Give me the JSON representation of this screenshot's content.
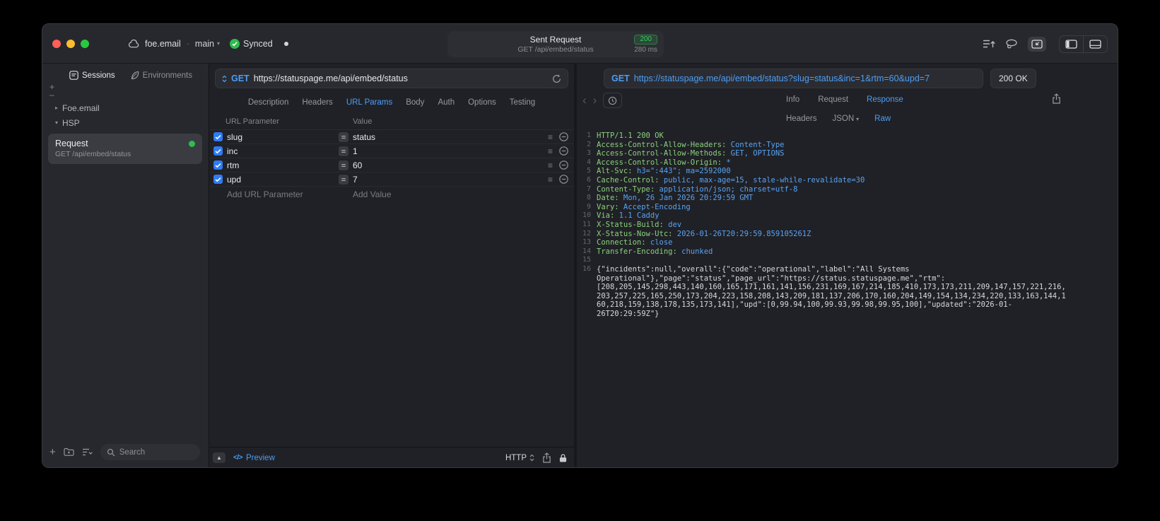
{
  "titlebar": {
    "project": "foe.email",
    "branch": "main",
    "sync_status": "Synced",
    "request_capsule": {
      "title": "Sent Request",
      "subtitle": "GET /api/embed/status",
      "status_code": "200",
      "duration": "280 ms"
    }
  },
  "sidebar": {
    "tabs": [
      {
        "label": "Sessions"
      },
      {
        "label": "Environments"
      }
    ],
    "tree": [
      {
        "label": "Foe.email"
      },
      {
        "label": "HSP"
      }
    ],
    "request_item": {
      "title": "Request",
      "subtitle": "GET /api/embed/status"
    },
    "search_placeholder": "Search"
  },
  "request": {
    "method": "GET",
    "url": "https://statuspage.me/api/embed/status",
    "tabs": [
      "Description",
      "Headers",
      "URL Params",
      "Body",
      "Auth",
      "Options",
      "Testing"
    ],
    "active_tab": "URL Params",
    "params_table": {
      "columns": [
        "URL Parameter",
        "Value"
      ],
      "rows": [
        {
          "enabled": true,
          "name": "slug",
          "value": "status"
        },
        {
          "enabled": true,
          "name": "inc",
          "value": "1"
        },
        {
          "enabled": true,
          "name": "rtm",
          "value": "60"
        },
        {
          "enabled": true,
          "name": "upd",
          "value": "7"
        }
      ],
      "add_row": {
        "name_placeholder": "Add URL Parameter",
        "value_placeholder": "Add Value"
      }
    },
    "footer": {
      "preview_label": "Preview",
      "protocol": "HTTP"
    }
  },
  "response": {
    "method": "GET",
    "url": "https://statuspage.me/api/embed/status?slug=status&inc=1&rtm=60&upd=7",
    "status": "200 OK",
    "tabs": [
      "Info",
      "Request",
      "Response"
    ],
    "active_tab": "Response",
    "subtabs": [
      "Headers",
      "JSON",
      "Raw"
    ],
    "active_subtab": "Raw",
    "body_lines": [
      {
        "n": "1",
        "parts": [
          {
            "t": "HTTP/1.1 200 OK",
            "c": "g"
          }
        ]
      },
      {
        "n": "2",
        "parts": [
          {
            "t": "Access-Control-Allow-Headers:",
            "c": "g"
          },
          {
            "t": " Content-Type",
            "c": "b"
          }
        ]
      },
      {
        "n": "3",
        "parts": [
          {
            "t": "Access-Control-Allow-Methods:",
            "c": "g"
          },
          {
            "t": " GET, OPTIONS",
            "c": "b"
          }
        ]
      },
      {
        "n": "4",
        "parts": [
          {
            "t": "Access-Control-Allow-Origin:",
            "c": "g"
          },
          {
            "t": " *",
            "c": "b"
          }
        ]
      },
      {
        "n": "5",
        "parts": [
          {
            "t": "Alt-Svc:",
            "c": "g"
          },
          {
            "t": " h3=\":443\"; ma=2592000",
            "c": "b"
          }
        ]
      },
      {
        "n": "6",
        "parts": [
          {
            "t": "Cache-Control:",
            "c": "g"
          },
          {
            "t": " public, max-age=15, stale-while-revalidate=30",
            "c": "b"
          }
        ]
      },
      {
        "n": "7",
        "parts": [
          {
            "t": "Content-Type:",
            "c": "g"
          },
          {
            "t": " application/json; charset=utf-8",
            "c": "b"
          }
        ]
      },
      {
        "n": "8",
        "parts": [
          {
            "t": "Date:",
            "c": "g"
          },
          {
            "t": " Mon, 26 Jan 2026 20:29:59 GMT",
            "c": "b"
          }
        ]
      },
      {
        "n": "9",
        "parts": [
          {
            "t": "Vary:",
            "c": "g"
          },
          {
            "t": " Accept-Encoding",
            "c": "b"
          }
        ]
      },
      {
        "n": "10",
        "parts": [
          {
            "t": "Via:",
            "c": "g"
          },
          {
            "t": " 1.1 Caddy",
            "c": "b"
          }
        ]
      },
      {
        "n": "11",
        "parts": [
          {
            "t": "X-Status-Build:",
            "c": "g"
          },
          {
            "t": " dev",
            "c": "b"
          }
        ]
      },
      {
        "n": "12",
        "parts": [
          {
            "t": "X-Status-Now-Utc:",
            "c": "g"
          },
          {
            "t": " 2026-01-26T20:29:59.859105261Z",
            "c": "b"
          }
        ]
      },
      {
        "n": "13",
        "parts": [
          {
            "t": "Connection:",
            "c": "g"
          },
          {
            "t": " close",
            "c": "b"
          }
        ]
      },
      {
        "n": "14",
        "parts": [
          {
            "t": "Transfer-Encoding:",
            "c": "g"
          },
          {
            "t": " chunked",
            "c": "b"
          }
        ]
      },
      {
        "n": "15",
        "parts": []
      },
      {
        "n": "16",
        "parts": [
          {
            "t": "{\"incidents\":null,\"overall\":{\"code\":\"operational\",\"label\":\"All Systems Operational\"},\"page\":\"status\",\"page_url\":\"https://status.statuspage.me\",\"rtm\":[208,205,145,298,443,140,160,165,171,161,141,156,231,169,167,214,185,410,173,173,211,209,147,157,221,216,203,257,225,165,250,173,204,223,158,208,143,209,181,137,206,170,160,204,149,154,134,234,220,133,163,144,160,218,159,138,178,135,173,141],\"upd\":[0,99.94,100,99.93,99.98,99.95,100],\"updated\":\"2026-01-26T20:29:59Z\"}",
            "c": "w"
          }
        ]
      }
    ]
  },
  "colors": {
    "accent_blue": "#4b9ef7",
    "success_green": "#30d158",
    "header_name_green": "#8bd17c",
    "header_value_blue": "#58a2f2"
  }
}
